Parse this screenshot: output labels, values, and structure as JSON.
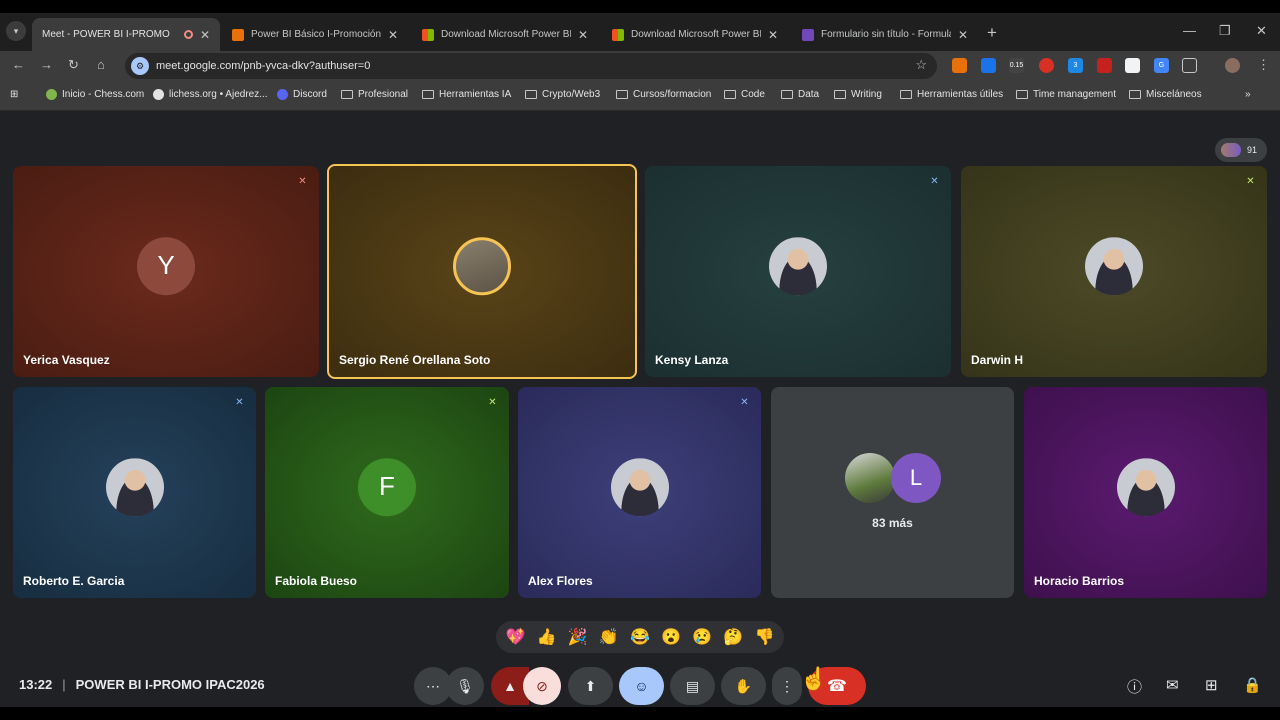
{
  "tabs": [
    {
      "title": "Meet - POWER BI I-PROMO"
    },
    {
      "title": "Power BI Básico I-Promoción IP"
    },
    {
      "title": "Download Microsoft Power BI D"
    },
    {
      "title": "Download Microsoft Power BI D"
    },
    {
      "title": "Formulario sin título - Formular"
    }
  ],
  "browser": {
    "url": "meet.google.com/pnb-yvca-dkv?authuser=0"
  },
  "toolbar": {
    "speed_badge": "0.15",
    "ext_badge": "3"
  },
  "bookmarks": [
    "Inicio - Chess.com",
    "lichess.org • Ajedrez...",
    "Discord",
    "Profesional",
    "Herramientas IA",
    "Crypto/Web3",
    "Cursos/formacion",
    "Code",
    "Data",
    "Writing",
    "Herramientas útiles",
    "Time management",
    "Misceláneos"
  ],
  "meeting": {
    "participant_count": "91",
    "time": "13:22",
    "title": "POWER BI I-PROMO IPAC2026",
    "more_initial": "L",
    "more_label": "83 más"
  },
  "participants": [
    {
      "name": "Yerica Vasquez",
      "initial": "Y"
    },
    {
      "name": "Sergio René Orellana Soto"
    },
    {
      "name": "Kensy Lanza"
    },
    {
      "name": "Darwin H"
    },
    {
      "name": "Roberto E. Garcia"
    },
    {
      "name": "Fabiola Bueso",
      "initial": "F"
    },
    {
      "name": "Alex Flores"
    },
    {
      "name": "Horacio Barrios"
    }
  ],
  "reactions": [
    "💖",
    "👍",
    "🎉",
    "👏",
    "😂",
    "😮",
    "😢",
    "🤔",
    "👎"
  ],
  "colors": {
    "background": "#202124",
    "speaker_highlight": "#f6c453",
    "end_call": "#d93025",
    "camera_off": "#8c1d18",
    "reactions_active": "#a8c7fa"
  }
}
